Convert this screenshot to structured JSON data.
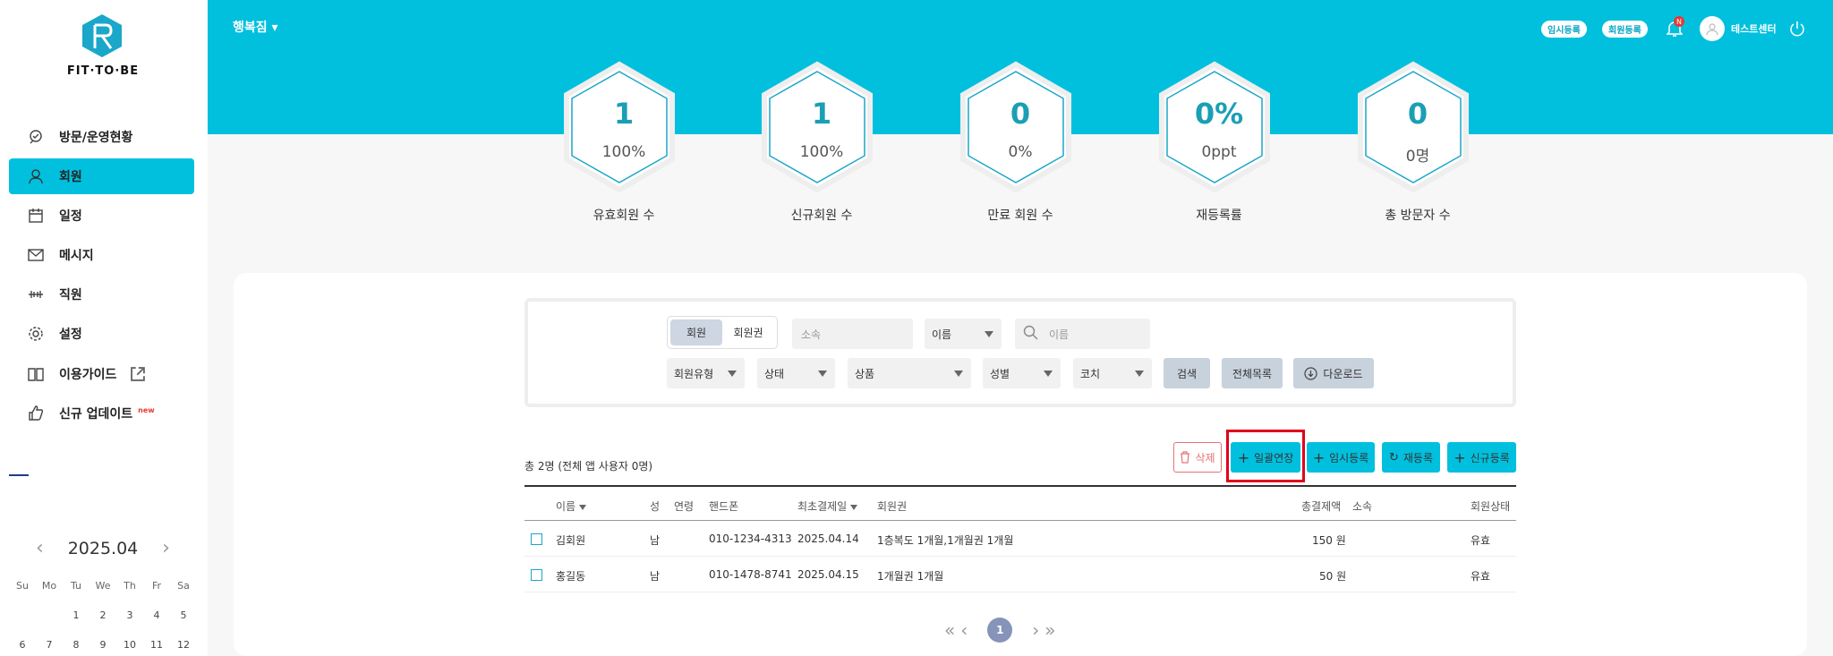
{
  "brand": {
    "name": "FIT·TO·BE"
  },
  "nav": [
    {
      "label": "방문/운영현황",
      "icon": "visit-icon"
    },
    {
      "label": "회원",
      "icon": "user-icon",
      "active": true
    },
    {
      "label": "일정",
      "icon": "calendar-icon"
    },
    {
      "label": "메시지",
      "icon": "mail-icon"
    },
    {
      "label": "직원",
      "icon": "dumbbell-icon"
    },
    {
      "label": "설정",
      "icon": "gear-icon"
    },
    {
      "label": "이용가이드",
      "icon": "book-icon"
    },
    {
      "label": "신규 업데이트",
      "icon": "thumbs-up-icon",
      "tag": "new"
    }
  ],
  "calendar": {
    "month": "2025.04",
    "weekdays": [
      "Su",
      "Mo",
      "Tu",
      "We",
      "Th",
      "Fr",
      "Sa"
    ],
    "days": [
      "",
      "",
      "1",
      "2",
      "3",
      "4",
      "5",
      "6",
      "7",
      "8",
      "9",
      "10",
      "11",
      "12"
    ]
  },
  "topbar": {
    "gym": "행복짐",
    "temp_register": "임시등록",
    "member_register": "회원등록",
    "notif_badge": "N",
    "user_name": "테스트센터"
  },
  "stats": [
    {
      "value": "1",
      "sub": "100%",
      "label": "유효회원 수"
    },
    {
      "value": "1",
      "sub": "100%",
      "label": "신규회원 수"
    },
    {
      "value": "0",
      "sub": "0%",
      "label": "만료 회원 수"
    },
    {
      "value": "0%",
      "sub": "0ppt",
      "label": "재등록률"
    },
    {
      "value": "0",
      "sub": "0명",
      "label": "총 방문자 수"
    }
  ],
  "filter": {
    "seg": [
      "회원",
      "회원권"
    ],
    "affiliation_placeholder": "소속",
    "name_select": "이름",
    "search_placeholder": "이름",
    "member_type": "회원유형",
    "status": "상태",
    "product": "상품",
    "gender": "성별",
    "coach": "코치",
    "search_btn": "검색",
    "all_btn": "전체목록",
    "download_btn": "다운로드"
  },
  "summary": "총 2명 (전체 앱 사용자 0명)",
  "actions": {
    "delete": "삭제",
    "bulk_extend": "일괄연장",
    "temp_register": "임시등록",
    "reregister": "재등록",
    "new_register": "신규등록"
  },
  "table": {
    "headers": [
      "이름",
      "성",
      "연령",
      "핸드폰",
      "최초결제일",
      "회원권",
      "총결제액",
      "소속",
      "회원상태"
    ],
    "rows": [
      {
        "name": "김회원",
        "gender": "남",
        "age": "",
        "phone": "010-1234-4313",
        "first_pay": "2025.04.14",
        "membership": "1층복도 1개월,1개월권 1개월",
        "total": "150 원",
        "affil": "",
        "status": "유효"
      },
      {
        "name": "홍길동",
        "gender": "남",
        "age": "",
        "phone": "010-1478-8741",
        "first_pay": "2025.04.15",
        "membership": "1개월권 1개월",
        "total": "50 원",
        "affil": "",
        "status": "유효"
      }
    ]
  },
  "pagination": {
    "current": "1"
  },
  "colors": {
    "accent": "#00c0de",
    "highlight": "#e0001b"
  }
}
